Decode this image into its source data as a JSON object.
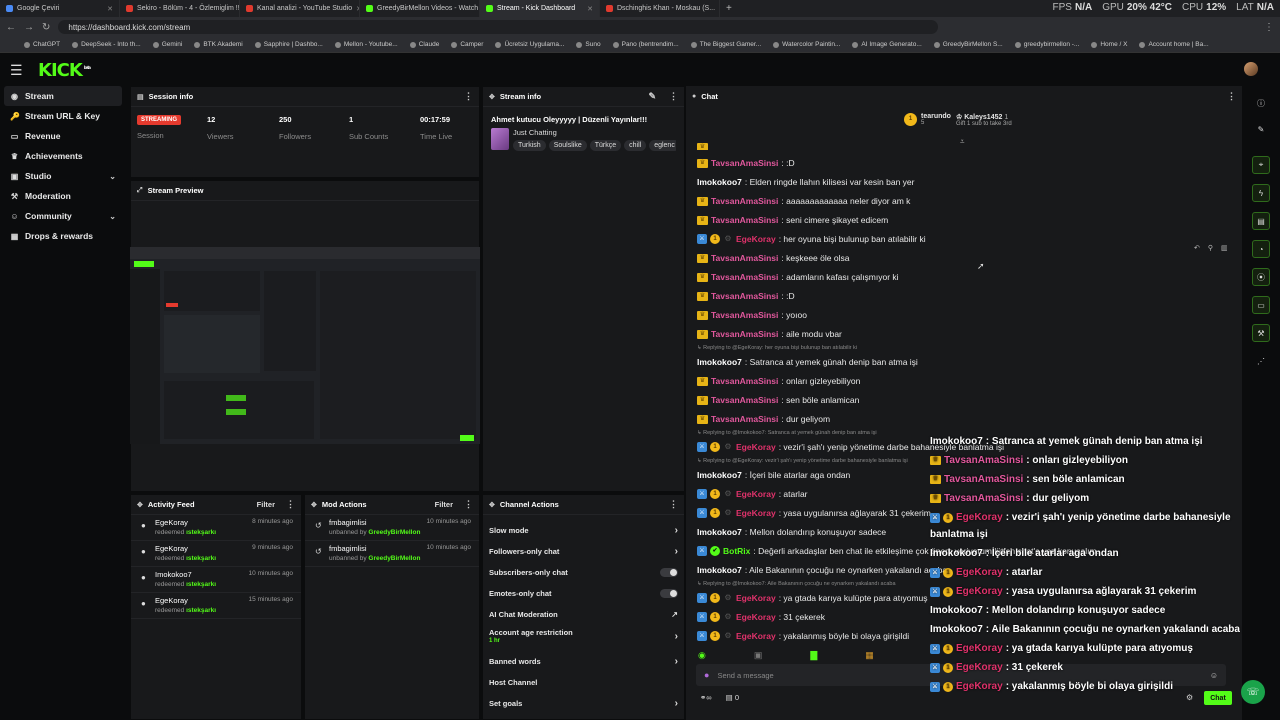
{
  "browser": {
    "tabs": [
      {
        "label": "Google Çeviri",
        "color": "#4a8af4",
        "active": false
      },
      {
        "label": "Sekiro - Bölüm - 4 - Özlemiglim !!!",
        "color": "#e03a2e",
        "active": false
      },
      {
        "label": "Kanal analizi - YouTube Studio",
        "color": "#e03a2e",
        "active": false
      },
      {
        "label": "GreedyBirMellon Videos - Watch ...",
        "color": "#53fc18",
        "active": false
      },
      {
        "label": "Stream - Kick Dashboard",
        "color": "#53fc18",
        "active": true
      },
      {
        "label": "Dschinghis Khan - Moskau (S...",
        "color": "#e03a2e",
        "active": false
      }
    ],
    "perf": {
      "fps_label": "FPS",
      "fps": "N/A",
      "gpu_label": "GPU",
      "gpu": "20% 42°C",
      "cpu_label": "CPU",
      "cpu": "12%",
      "lat_label": "LAT",
      "lat": "N/A"
    },
    "url": "https://dashboard.kick.com/stream",
    "bookmarks": [
      "ChatGPT",
      "DeepSeek - Into th...",
      "Gemini",
      "BTK Akademi",
      "Sapphire | Dashbo...",
      "Mellon - Youtube...",
      "Claude",
      "Camper",
      "Ücretsiz Uygulama...",
      "Suno",
      "Pano (bentrendim...",
      "The Biggest Gamer...",
      "Watercolor Paintin...",
      "AI Image Generato...",
      "GreedyBirMellon S...",
      "greedybirmellon -...",
      "Home / X",
      "Account home | Ba..."
    ]
  },
  "app": {
    "logo": "KICK",
    "logo_sup": "beta"
  },
  "sidebar": {
    "items": [
      {
        "label": "Stream",
        "icon": "broadcast-icon",
        "glyph": "◉"
      },
      {
        "label": "Stream URL & Key",
        "icon": "key-icon",
        "glyph": "🔑"
      },
      {
        "label": "Revenue",
        "icon": "wallet-icon",
        "glyph": "▭"
      },
      {
        "label": "Achievements",
        "icon": "trophy-icon",
        "glyph": "♛"
      },
      {
        "label": "Studio",
        "icon": "studio-icon",
        "glyph": "▣"
      },
      {
        "label": "Moderation",
        "icon": "hammer-icon",
        "glyph": "⚒"
      },
      {
        "label": "Community",
        "icon": "community-icon",
        "glyph": "☺"
      },
      {
        "label": "Drops & rewards",
        "icon": "gift-icon",
        "glyph": "▦"
      }
    ]
  },
  "session": {
    "title": "Session info",
    "status": "STREAMING",
    "status_label": "Session",
    "viewers": "12",
    "viewers_label": "Viewers",
    "followers": "250",
    "followers_label": "Followers",
    "subs": "1",
    "subs_label": "Sub Counts",
    "time": "00:17:59",
    "time_label": "Time Live"
  },
  "preview": {
    "title": "Stream Preview"
  },
  "stream_info": {
    "title": "Stream info",
    "stream_title": "Ahmet kutucu Oleyyyyy | Düzenli Yayınlar!!!",
    "category": "Just Chatting",
    "tags": [
      "Turkish",
      "Soulslike",
      "Türkçe",
      "chill",
      "eglenc"
    ]
  },
  "activity": {
    "title": "Activity Feed",
    "filter": "Filter",
    "items": [
      {
        "name": "EgeKoray",
        "action": "redeemed",
        "reward": "ıstekşarkı",
        "time": "8 minutes ago"
      },
      {
        "name": "EgeKoray",
        "action": "redeemed",
        "reward": "ıstekşarkı",
        "time": "9 minutes ago"
      },
      {
        "name": "Imokokoo7",
        "action": "redeemed",
        "reward": "ıstekşarkı",
        "time": "10 minutes ago"
      },
      {
        "name": "EgeKoray",
        "action": "redeemed",
        "reward": "ıstekşarkı",
        "time": "15 minutes ago"
      }
    ]
  },
  "mod_actions": {
    "title": "Mod Actions",
    "filter": "Filter",
    "items": [
      {
        "name": "fmbagimlisi",
        "action": "unbanned by",
        "by": "GreedyBirMellon",
        "time": "10 minutes ago"
      },
      {
        "name": "fmbagimlisi",
        "action": "unbanned by",
        "by": "GreedyBirMellon",
        "time": "10 minutes ago"
      }
    ]
  },
  "channel_actions": {
    "title": "Channel Actions",
    "slow": "Slow mode",
    "followers_only": "Followers-only chat",
    "subs_only": "Subscribers-only chat",
    "emotes_only": "Emotes-only chat",
    "ai_mod": "AI Chat Moderation",
    "age": "Account age restriction",
    "age_value": "1 hr",
    "banned": "Banned words",
    "host": "Host Channel",
    "goals": "Set goals"
  },
  "chat": {
    "title": "Chat",
    "top1_name": "tearundo",
    "top1_count": "5",
    "top2_name": "Kaleys1452",
    "top2_count": "1",
    "top2_sub": "Gift 1 sub to take 3rd",
    "input_placeholder": "Send a message",
    "send": "Chat",
    "viewer_count": "0",
    "messages": [
      {
        "type": "msg",
        "badges": [
          "crown"
        ],
        "user": "TavsanAmaSinsi",
        "color": "#e2589d",
        "text": ": :D"
      },
      {
        "type": "msg",
        "badges": [],
        "user": "Imokokoo7",
        "color": "#ffffff",
        "text": ": Elden ringde llahın kilisesi var kesin ban yer"
      },
      {
        "type": "msg",
        "badges": [
          "crown"
        ],
        "user": "TavsanAmaSinsi",
        "color": "#e2589d",
        "text": ": aaaaaaaaaaaaa neler diyor am k"
      },
      {
        "type": "msg",
        "badges": [
          "crown"
        ],
        "user": "TavsanAmaSinsi",
        "color": "#e2589d",
        "text": ": seni cimere şikayet edicem"
      },
      {
        "type": "msg",
        "badges": [
          "blu",
          "gold",
          "gear"
        ],
        "user": "EgeKoray",
        "color": "#e0326b",
        "text": ": her oyuna bişi bulunup ban atılabilir ki"
      },
      {
        "type": "msg",
        "badges": [
          "crown"
        ],
        "user": "TavsanAmaSinsi",
        "color": "#e2589d",
        "text": ": keşkeee öle olsa"
      },
      {
        "type": "msg",
        "badges": [
          "crown"
        ],
        "user": "TavsanAmaSinsi",
        "color": "#e2589d",
        "text": ": adamların kafası çalışmıyor ki"
      },
      {
        "type": "msg",
        "badges": [
          "crown"
        ],
        "user": "TavsanAmaSinsi",
        "color": "#e2589d",
        "text": ": :D"
      },
      {
        "type": "msg",
        "badges": [
          "crown"
        ],
        "user": "TavsanAmaSinsi",
        "color": "#e2589d",
        "text": ": yoıoo"
      },
      {
        "type": "msg",
        "badges": [
          "crown"
        ],
        "user": "TavsanAmaSinsi",
        "color": "#e2589d",
        "text": ": aile modu vbar"
      },
      {
        "type": "reply",
        "text": "↳ Replying to @EgeKoray: her oyuna bişi bulunup ban atılabilir ki"
      },
      {
        "type": "msg",
        "badges": [],
        "user": "Imokokoo7",
        "color": "#ffffff",
        "text": ": Satranca at yemek günah denip ban atma işi"
      },
      {
        "type": "msg",
        "badges": [
          "crown"
        ],
        "user": "TavsanAmaSinsi",
        "color": "#e2589d",
        "text": ": onları gizleyebiliyon"
      },
      {
        "type": "msg",
        "badges": [
          "crown"
        ],
        "user": "TavsanAmaSinsi",
        "color": "#e2589d",
        "text": ": sen böle anlamican"
      },
      {
        "type": "msg",
        "badges": [
          "crown"
        ],
        "user": "TavsanAmaSinsi",
        "color": "#e2589d",
        "text": ": dur geliyom"
      },
      {
        "type": "reply",
        "text": "↳ Replying to @Imokokoo7: Satranca at yemek günah denip ban atma işi"
      },
      {
        "type": "msg",
        "badges": [
          "blu",
          "gold",
          "gear"
        ],
        "user": "EgeKoray",
        "color": "#e0326b",
        "text": ": vezir'i şah'ı yenip yönetime darbe bahanesiyle banlatma işi"
      },
      {
        "type": "reply",
        "text": "↳ Replying to @EgeKoray: vezir'i şah'ı yenip yönetime darbe bahanesiyle banlatma işi"
      },
      {
        "type": "msg",
        "badges": [],
        "user": "Imokokoo7",
        "color": "#ffffff",
        "text": ": İçeri bile atarlar aga ondan"
      },
      {
        "type": "msg",
        "badges": [
          "blu",
          "gold",
          "gear"
        ],
        "user": "EgeKoray",
        "color": "#e0326b",
        "text": ": atarlar"
      },
      {
        "type": "msg",
        "badges": [
          "blu",
          "gold",
          "gear"
        ],
        "user": "EgeKoray",
        "color": "#e0326b",
        "text": ": yasa uygulanırsa ağlayarak 31 çekerim"
      },
      {
        "type": "msg",
        "badges": [],
        "user": "Imokokoo7",
        "color": "#ffffff",
        "text": ": Mellon dolandırıp konuşuyor sadece"
      },
      {
        "type": "msg",
        "badges": [
          "blu",
          "bot"
        ],
        "user": "BotRix",
        "color": "#53fc18",
        "text": ": Değerli arkadaşlar ben chat ile etkileşime çok önem veriyorum lütfen chat'e yaz konuşalım."
      },
      {
        "type": "msg",
        "badges": [],
        "user": "Imokokoo7",
        "color": "#ffffff",
        "text": ": Aile Bakanının çocuğu ne oynarken yakalandı acaba"
      },
      {
        "type": "reply",
        "text": "↳ Replying to @Imokokoo7: Aile Bakanının çocuğu ne oynarken yakalandı acaba"
      },
      {
        "type": "msg",
        "badges": [
          "blu",
          "gold",
          "gear"
        ],
        "user": "EgeKoray",
        "color": "#e0326b",
        "text": ": ya gtada karıya kulüpte para atıyomuş"
      },
      {
        "type": "msg",
        "badges": [
          "blu",
          "gold",
          "gear"
        ],
        "user": "EgeKoray",
        "color": "#e0326b",
        "text": ": 31 çekerek"
      },
      {
        "type": "msg",
        "badges": [
          "blu",
          "gold",
          "gear"
        ],
        "user": "EgeKoray",
        "color": "#e0326b",
        "text": ": yakalanmış böyle bi olaya girişildi"
      }
    ]
  },
  "overlay": {
    "lines": [
      {
        "badges": [],
        "user": "Imokokoo7",
        "color": "#ffffff",
        "text": " : Satranca at yemek günah denip ban atma işi"
      },
      {
        "badges": [
          "crown"
        ],
        "user": "TavsanAmaSinsi",
        "color": "#e2589d",
        "text": " : onları gizleyebiliyon"
      },
      {
        "badges": [
          "crown"
        ],
        "user": "TavsanAmaSinsi",
        "color": "#e2589d",
        "text": " : sen böle anlamican"
      },
      {
        "badges": [
          "crown"
        ],
        "user": "TavsanAmaSinsi",
        "color": "#e2589d",
        "text": " : dur geliyom"
      },
      {
        "badges": [
          "blu",
          "gold"
        ],
        "user": "EgeKoray",
        "color": "#e0326b",
        "text": " : vezir'i şah'ı yenip yönetime darbe bahanesiyle"
      },
      {
        "badges": [],
        "user": "",
        "color": "#ffffff",
        "text": "banlatma işi"
      },
      {
        "badges": [],
        "user": "Imokokoo7",
        "color": "#ffffff",
        "text": " : İçeri bile atarlar aga ondan"
      },
      {
        "badges": [
          "blu",
          "gold"
        ],
        "user": "EgeKoray",
        "color": "#e0326b",
        "text": " : atarlar"
      },
      {
        "badges": [
          "blu",
          "gold"
        ],
        "user": "EgeKoray",
        "color": "#e0326b",
        "text": " : yasa uygulanırsa ağlayarak 31 çekerim"
      },
      {
        "badges": [],
        "user": "Imokokoo7",
        "color": "#ffffff",
        "text": " : Mellon dolandırıp konuşuyor sadece"
      },
      {
        "badges": [],
        "user": "Imokokoo7",
        "color": "#ffffff",
        "text": " : Aile Bakanının çocuğu ne oynarken yakalandı acaba"
      },
      {
        "badges": [
          "blu",
          "gold"
        ],
        "user": "EgeKoray",
        "color": "#e0326b",
        "text": " : ya gtada karıya kulüpte para atıyomuş"
      },
      {
        "badges": [
          "blu",
          "gold"
        ],
        "user": "EgeKoray",
        "color": "#e0326b",
        "text": " : 31 çekerek"
      },
      {
        "badges": [
          "blu",
          "gold"
        ],
        "user": "EgeKoray",
        "color": "#e0326b",
        "text": " : yakalanmış böyle bi olaya girişildi"
      }
    ]
  },
  "rail": {
    "icons": [
      "info-icon",
      "edit-icon",
      "scan-icon",
      "bolt-icon",
      "document-icon",
      "chat-bubble-icon",
      "broadcast-icon",
      "layout-icon",
      "wrench-icon",
      "nodes-icon"
    ]
  },
  "colors": {
    "brand": "#53fc18",
    "live": "#e53a2e",
    "panel": "#18191b",
    "bg": "#0b0c0d"
  }
}
